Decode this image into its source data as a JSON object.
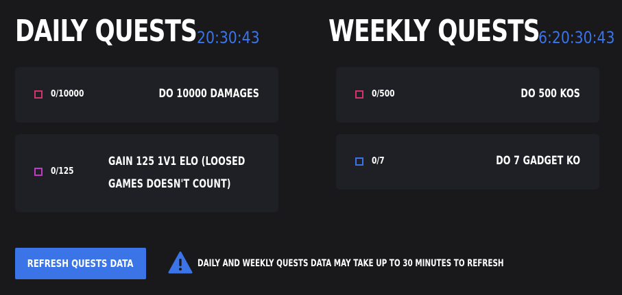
{
  "daily": {
    "title": "DAILY QUESTS",
    "timer": "20:30:43",
    "quests": [
      {
        "progress": "0/10000",
        "name": "DO 10000 DAMAGES",
        "checkbox_color": "#d6336c"
      },
      {
        "progress": "0/125",
        "name": "GAIN 125 1V1 ELO (LOOSED GAMES DOESN'T COUNT)",
        "checkbox_color": "#c23bc4"
      }
    ]
  },
  "weekly": {
    "title": "WEEKLY QUESTS",
    "timer": "6:20:30:43",
    "quests": [
      {
        "progress": "0/500",
        "name": "DO 500 KOS",
        "checkbox_color": "#d6336c"
      },
      {
        "progress": "0/7",
        "name": "DO 7 GADGET KO",
        "checkbox_color": "#3b74e6"
      }
    ]
  },
  "footer": {
    "refresh_label": "REFRESH QUESTS DATA",
    "notice": "DAILY AND WEEKLY QUESTS DATA MAY TAKE UP TO 30 MINUTES TO REFRESH",
    "warning_icon": "warning-triangle-icon",
    "warning_color": "#3b74e6"
  },
  "colors": {
    "accent": "#3b74e6",
    "background": "#19191c",
    "card": "#1f2026"
  }
}
